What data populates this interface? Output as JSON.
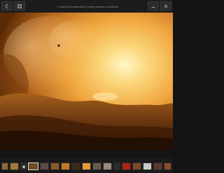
{
  "titlebar": {
    "caption": "1 image of the selected in current selection is selected"
  },
  "icons": {
    "left_buttons": [
      "back-icon",
      "grid-icon"
    ],
    "right_buttons": [
      "minimize-icon",
      "close-icon"
    ],
    "film_strip_markers": [
      "star-icon"
    ]
  },
  "viewer": {
    "subject": "molten lava glowing orange"
  },
  "filmstrip": {
    "thumbnail_count": 20,
    "selected_index": 3
  },
  "colors": {
    "chrome": "#1c1c1c",
    "accent_fire": "#f6a23a",
    "selection_border": "#d9d9d9"
  }
}
